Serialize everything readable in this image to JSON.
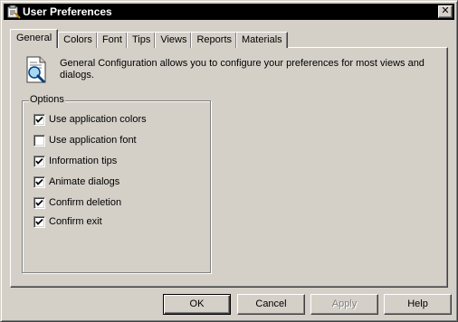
{
  "window": {
    "title": "User Preferences",
    "close_glyph": "✕"
  },
  "tabs": [
    {
      "label": "General",
      "active": true
    },
    {
      "label": "Colors",
      "active": false
    },
    {
      "label": "Font",
      "active": false
    },
    {
      "label": "Tips",
      "active": false
    },
    {
      "label": "Views",
      "active": false
    },
    {
      "label": "Reports",
      "active": false
    },
    {
      "label": "Materials",
      "active": false
    }
  ],
  "general": {
    "description": "General Configuration allows you to configure your preferences for most views and dialogs.",
    "icon": "document-magnifier-icon",
    "options_label": "Options",
    "options": [
      {
        "label": "Use application colors",
        "checked": true
      },
      {
        "label": "Use application font",
        "checked": false
      },
      {
        "label": "Information tips",
        "checked": true
      },
      {
        "label": "Animate dialogs",
        "checked": true
      },
      {
        "label": "Confirm deletion",
        "checked": true
      },
      {
        "label": "Confirm exit",
        "checked": true
      }
    ]
  },
  "buttons": {
    "ok": "OK",
    "cancel": "Cancel",
    "apply": "Apply",
    "help": "Help"
  }
}
